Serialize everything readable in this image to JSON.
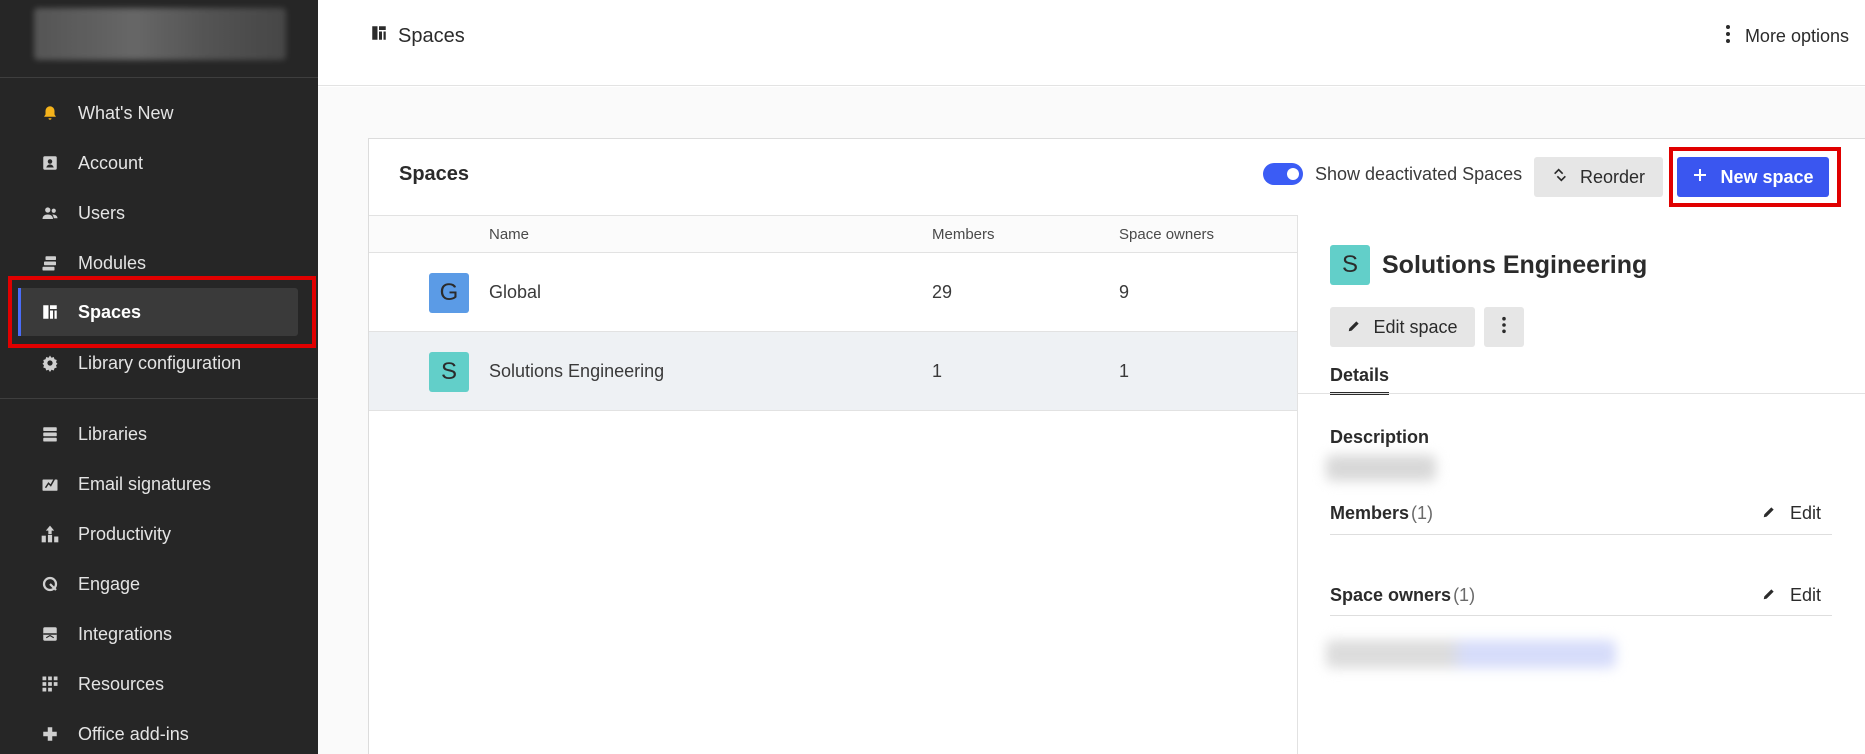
{
  "sidebar": {
    "groups": [
      [
        {
          "label": "What's New",
          "icon": "bell-icon"
        },
        {
          "label": "Account",
          "icon": "account-icon"
        },
        {
          "label": "Users",
          "icon": "users-icon"
        },
        {
          "label": "Modules",
          "icon": "modules-icon"
        },
        {
          "label": "Spaces",
          "icon": "spaces-icon",
          "active": true
        },
        {
          "label": "Library configuration",
          "icon": "gear-icon"
        }
      ],
      [
        {
          "label": "Libraries",
          "icon": "libraries-icon"
        },
        {
          "label": "Email signatures",
          "icon": "email-signature-icon"
        },
        {
          "label": "Productivity",
          "icon": "productivity-icon"
        },
        {
          "label": "Engage",
          "icon": "engage-icon"
        },
        {
          "label": "Integrations",
          "icon": "integrations-icon"
        },
        {
          "label": "Resources",
          "icon": "resources-icon"
        },
        {
          "label": "Office add-ins",
          "icon": "office-addins-icon"
        }
      ]
    ]
  },
  "header": {
    "title": "Spaces",
    "more_options": "More options"
  },
  "card": {
    "title": "Spaces",
    "toggle_label": "Show deactivated Spaces",
    "toggle_on": true,
    "reorder_label": "Reorder",
    "new_space_label": "New space"
  },
  "table": {
    "columns": [
      "Name",
      "Members",
      "Space owners"
    ],
    "rows": [
      {
        "initial": "G",
        "name": "Global",
        "members": "29",
        "owners": "9",
        "color": "#5b9be6",
        "selected": false
      },
      {
        "initial": "S",
        "name": "Solutions Engineering",
        "members": "1",
        "owners": "1",
        "color": "#62cfc9",
        "selected": true
      }
    ]
  },
  "panel": {
    "initial": "S",
    "title": "Solutions Engineering",
    "edit_space_label": "Edit space",
    "tab_details": "Details",
    "description_label": "Description",
    "members_label": "Members",
    "members_count": "(1)",
    "owners_label": "Space owners",
    "owners_count": "(1)",
    "edit_label": "Edit"
  },
  "colors": {
    "accent": "#3a56f0",
    "sidebar_bg": "#262626",
    "highlight": "#e00000"
  }
}
